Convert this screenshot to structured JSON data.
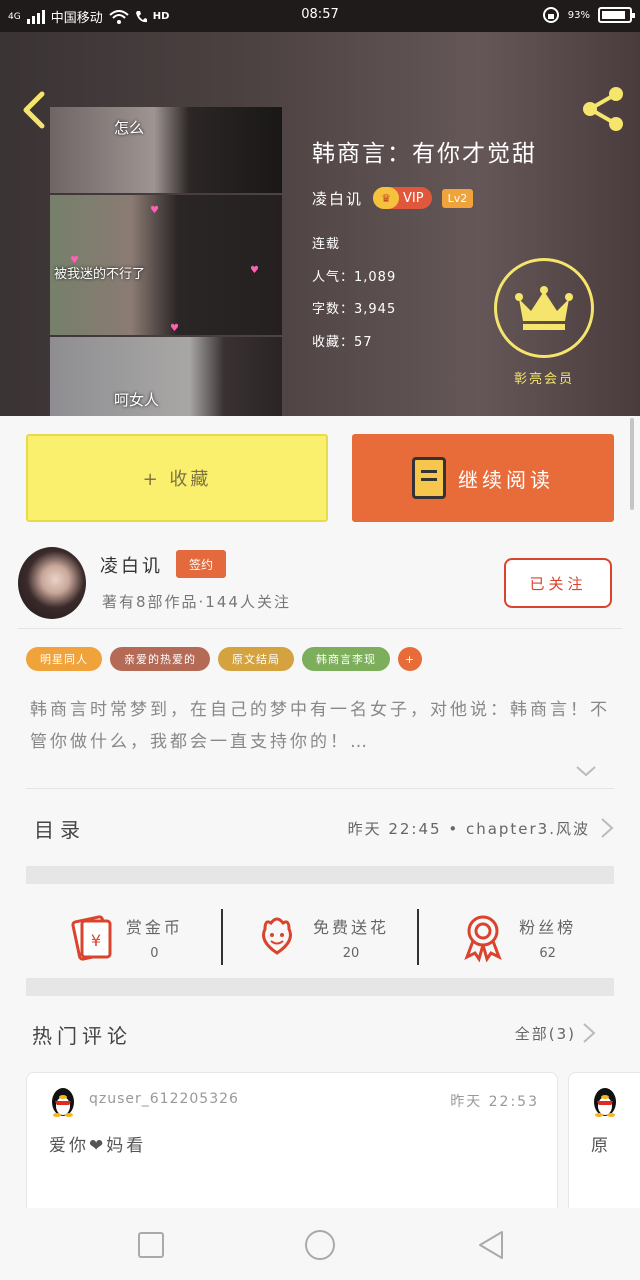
{
  "status_bar": {
    "carrier": "中国移动",
    "network": "4G",
    "hd_label": "HD",
    "time": "08:57",
    "battery": "93%"
  },
  "header": {
    "back_icon": "chevron-left-icon",
    "share_icon": "share-icon"
  },
  "cover": {
    "captions": [
      "怎么",
      "被我迷的不行了",
      "呵女人"
    ]
  },
  "book": {
    "title": "韩商言：有你才觉甜",
    "author": "凌白讥",
    "vip_label": "VIP",
    "level": "Lv2",
    "status": "连载",
    "popularity": "人气：1,089",
    "word_count": "字数：3,945",
    "favorites": "收藏：57",
    "member_label": "彰亮会员",
    "accent_color": "#f5e56c"
  },
  "actions": {
    "collect_label": "+ 收藏",
    "read_label": "继续阅读"
  },
  "author_info": {
    "name": "凌白讥",
    "badge": "签约",
    "stats": "著有8部作品·144人关注",
    "follow_label": "已关注"
  },
  "tags": [
    {
      "label": "明星同人",
      "color": "#f0a33a"
    },
    {
      "label": "亲爱的热爱的",
      "color": "#b56a55"
    },
    {
      "label": "原文结局",
      "color": "#d4a23e"
    },
    {
      "label": "韩商言李现",
      "color": "#7cae5c"
    },
    {
      "label": "+",
      "color": "#e86b3a"
    }
  ],
  "description": "韩商言时常梦到，在自己的梦中有一名女子，对他说：韩商言！不管你做什么，我都会一直支持你的！…",
  "toc": {
    "title": "目录",
    "latest": "昨天 22:45 • chapter3.风波"
  },
  "stats": [
    {
      "icon": "red-envelope-icon",
      "label": "赏金币",
      "value": "0"
    },
    {
      "icon": "flower-icon",
      "label": "免费送花",
      "value": "20"
    },
    {
      "icon": "rosette-icon",
      "label": "粉丝榜",
      "value": "62"
    }
  ],
  "comments": {
    "title": "热门评论",
    "all_label": "全部(3)",
    "items": [
      {
        "user": "qzuser_612205326",
        "time": "昨天 22:53",
        "text": "爱你❤妈看"
      },
      {
        "user": "",
        "time": "",
        "text": "原"
      }
    ]
  },
  "navbar": {
    "recent": "square-icon",
    "home": "circle-icon",
    "back": "triangle-back-icon"
  }
}
